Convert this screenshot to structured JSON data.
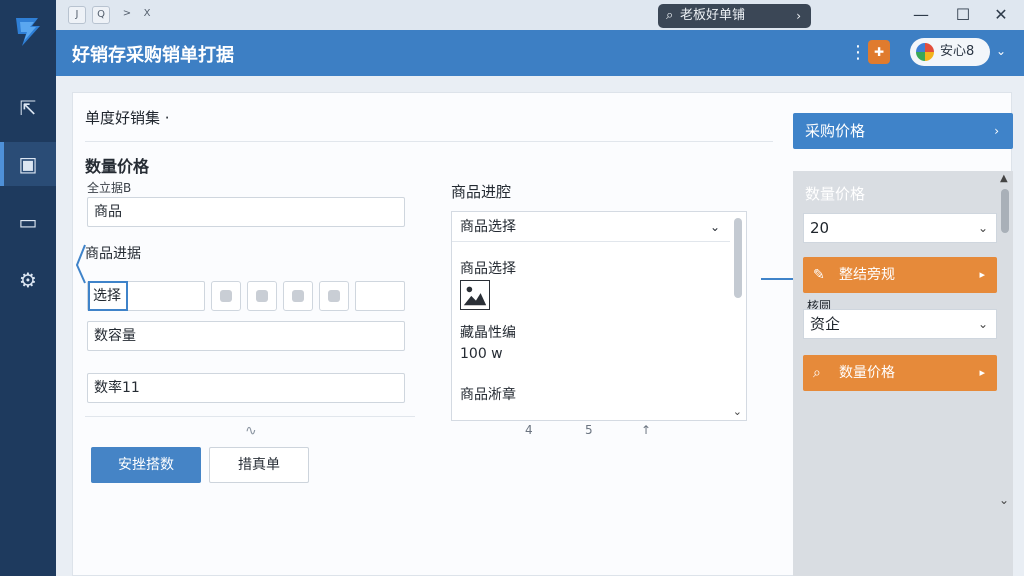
{
  "window": {
    "search_text": "老板好单铺",
    "title_chips": [
      "J",
      "Q",
      ">",
      "X"
    ],
    "minimize_glyph": "—",
    "maximize_glyph": "☐",
    "close_glyph": "✕"
  },
  "header": {
    "title": "好销存采购销单打据",
    "user_label": "安心8"
  },
  "breadcrumb": "单度好销集 ·",
  "purchase_button": "采购价格",
  "left_form": {
    "section_title": "数量价格",
    "sub_label": "全立据B",
    "product_field": "商品",
    "product_entry_label": "商品进据",
    "choose_value": "选择",
    "quantity_field": "数容量",
    "number_field": "数率11",
    "primary_button": "安挫搭数",
    "secondary_button": "措真单"
  },
  "middle": {
    "title": "商品进腔",
    "select_value": "商品选择",
    "item1_label": "商品选择",
    "item2_label": "藏晶性编",
    "item2_value": "100 w",
    "item3_label": "商品淅章",
    "pager": [
      "4",
      "5",
      "↑"
    ]
  },
  "right_panel": {
    "title": "数量价格",
    "qty_value": "20",
    "orange_button_1": "整结旁规",
    "small_label": "核圆",
    "select_value": "资企",
    "orange_button_2": "数量价格"
  },
  "colors": {
    "sidebar": "#1e3a5e",
    "header": "#3d7fc4",
    "accent": "#3f83c9",
    "orange": "#e68a3a"
  }
}
